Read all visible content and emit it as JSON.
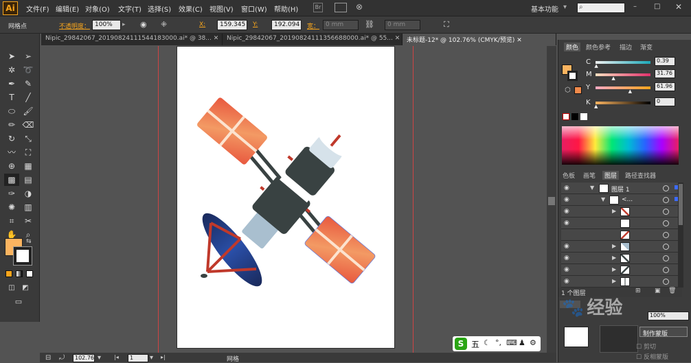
{
  "app": {
    "logo": "Ai"
  },
  "menu": [
    "文件(F)",
    "编辑(E)",
    "对象(O)",
    "文字(T)",
    "选择(S)",
    "效果(C)",
    "视图(V)",
    "窗口(W)",
    "帮助(H)"
  ],
  "workspace": {
    "label": "基本功能"
  },
  "control_bar": {
    "selection_label": "网格点",
    "opacity_label": "不透明度：",
    "opacity_value": "100%",
    "x_label": "X:",
    "x_value": "159.345",
    "y_label": "Y:",
    "y_value": "192.094",
    "width_label": "宽：",
    "width_value": "0 mm",
    "height_value": "0 mm"
  },
  "tabs": [
    {
      "label": "Nipic_29842067_20190824111544183000.ai* @ 38...",
      "active": false
    },
    {
      "label": "Nipic_29842067_20190824111356688000.ai* @ 55...",
      "active": false
    },
    {
      "label": "未标题-12* @ 102.76% (CMYK/预览)",
      "active": true
    }
  ],
  "color_panel": {
    "tabs": [
      "颜色",
      "颜色参考",
      "描边",
      "渐变"
    ],
    "channels": [
      {
        "label": "C",
        "value": "0.39",
        "fraction": 0.004
      },
      {
        "label": "M",
        "value": "31.76",
        "fraction": 0.3176
      },
      {
        "label": "Y",
        "value": "61.96",
        "fraction": 0.6196
      },
      {
        "label": "K",
        "value": "0",
        "fraction": 0
      }
    ],
    "fill_color": "#fbb460"
  },
  "layers_panel": {
    "tabs": [
      "色板",
      "画笔",
      "图层",
      "路径查找器"
    ],
    "top_layer": "图层 1",
    "group_label": "<...",
    "footer": "1 个图层"
  },
  "status_bar": {
    "zoom": "102.76",
    "page": "1",
    "tool_name": "网格"
  },
  "overlay": {
    "ime_label": "五",
    "watermark": "经验",
    "transparency_options": [
      "制作蒙版",
      "剪切",
      "反相蒙版"
    ],
    "transparency_percent": "100%"
  },
  "colors": {
    "accent": "#f7a51c",
    "panel_orange": "#f08a4b",
    "satellite_dark": "#394242",
    "satellite_light": "#a9bfcf",
    "dish_blue": "#1d3b84",
    "strut_red": "#c0392b"
  }
}
